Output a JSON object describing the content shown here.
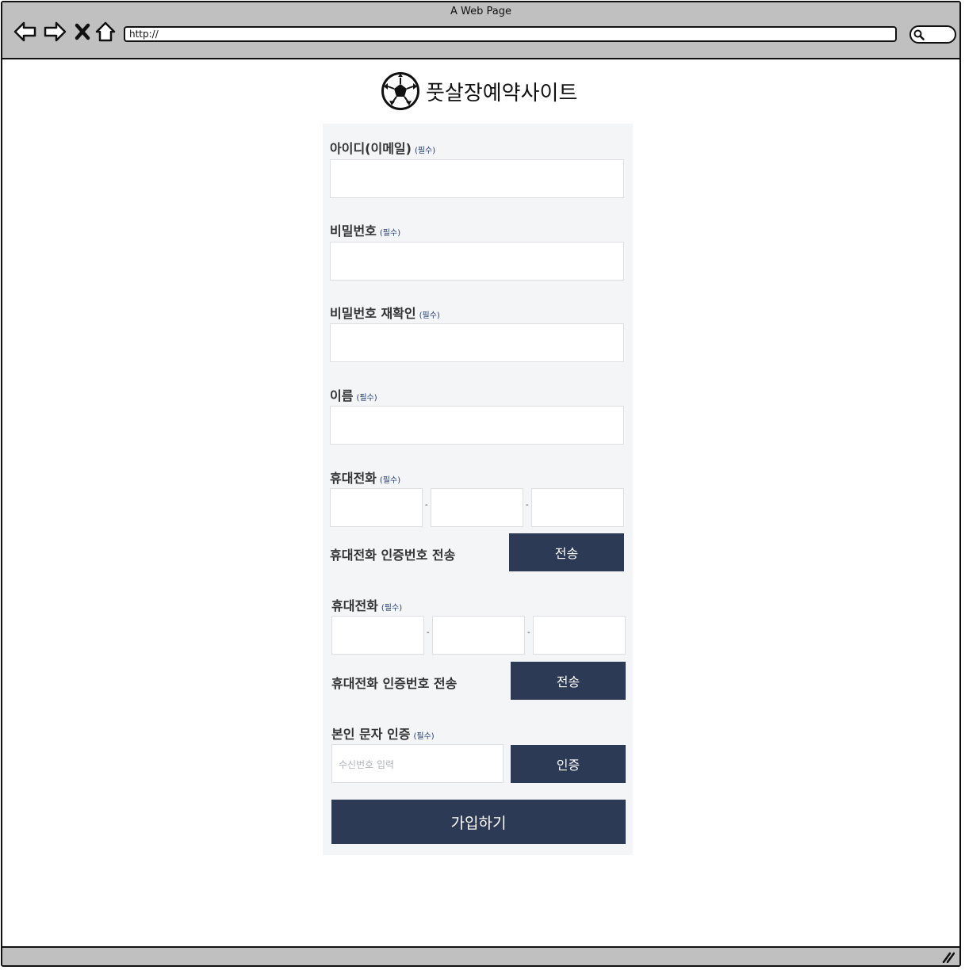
{
  "window": {
    "title": "A Web Page",
    "url": "http://"
  },
  "brand": {
    "name": "풋살장예약사이트"
  },
  "form": {
    "required_mark": "(필수)",
    "id_label": "아이디(이메일)",
    "password_label": "비밀번호",
    "password_confirm_label": "비밀번호 재확인",
    "name_label": "이름",
    "phone1_label": "휴대전화",
    "phone1_send_label": "휴대전화 인증번호 전송",
    "phone1_send_button": "전송",
    "phone2_label": "휴대전화",
    "phone2_send_label": "휴대전화 인증번호 전송",
    "phone2_send_button": "전송",
    "sms_label": "본인 문자 인증",
    "sms_placeholder": "수신번호 입력",
    "sms_button": "인증",
    "phone_separator": "-",
    "submit_button": "가입하기"
  },
  "colors": {
    "button_bg": "#2d3a55",
    "panel_bg": "#f4f5f7",
    "required_text": "#1f3a6e",
    "chrome_gray": "#c0c0c0"
  }
}
